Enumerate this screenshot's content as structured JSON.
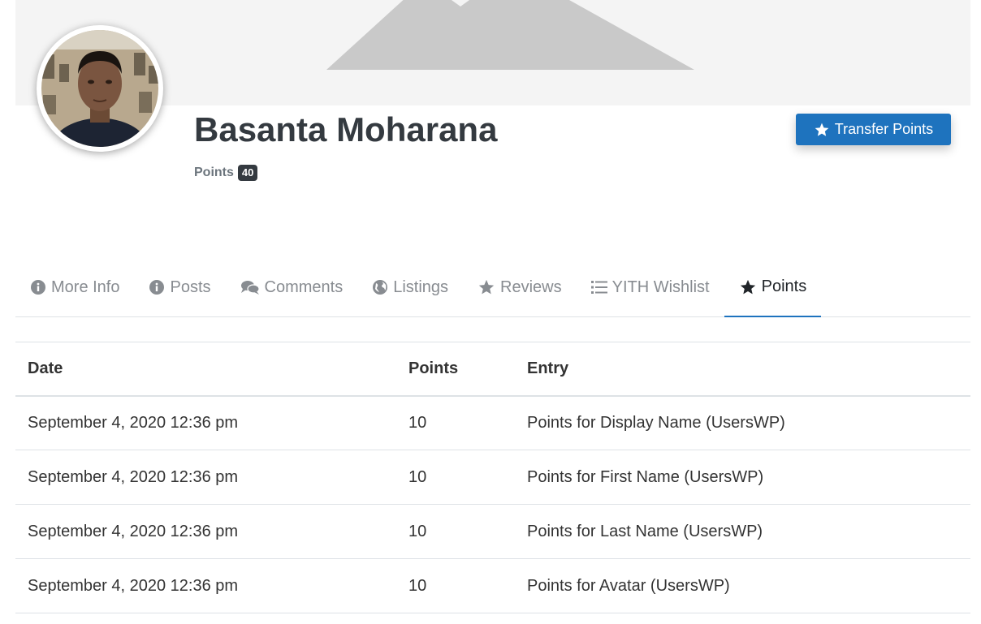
{
  "profile": {
    "name": "Basanta Moharana",
    "points_label": "Points",
    "points_value": "40",
    "transfer_button_label": "Transfer Points"
  },
  "tabs": [
    {
      "label": "More Info",
      "icon": "info-circle-icon"
    },
    {
      "label": "Posts",
      "icon": "info-circle-icon"
    },
    {
      "label": "Comments",
      "icon": "comments-icon"
    },
    {
      "label": "Listings",
      "icon": "globe-icon"
    },
    {
      "label": "Reviews",
      "icon": "star-icon"
    },
    {
      "label": "YITH Wishlist",
      "icon": "list-icon"
    },
    {
      "label": "Points",
      "icon": "star-icon",
      "active": true
    }
  ],
  "table": {
    "headers": [
      "Date",
      "Points",
      "Entry"
    ],
    "rows": [
      {
        "date": "September 4, 2020 12:36 pm",
        "points": "10",
        "entry": "Points for Display Name (UsersWP)"
      },
      {
        "date": "September 4, 2020 12:36 pm",
        "points": "10",
        "entry": "Points for First Name (UsersWP)"
      },
      {
        "date": "September 4, 2020 12:36 pm",
        "points": "10",
        "entry": "Points for Last Name (UsersWP)"
      },
      {
        "date": "September 4, 2020 12:36 pm",
        "points": "10",
        "entry": "Points for Avatar (UsersWP)"
      }
    ]
  },
  "colors": {
    "accent": "#1e73be",
    "badge": "#343a40",
    "tab_inactive": "#888c91",
    "tab_active": "#212529",
    "cover_bg": "#f4f4f4",
    "cover_mountain": "#c9c9c9"
  }
}
